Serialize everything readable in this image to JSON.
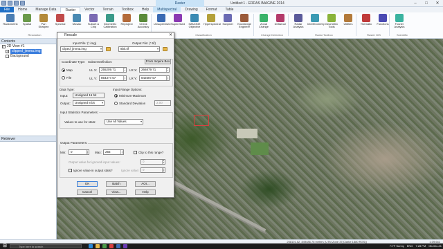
{
  "window": {
    "title": "Untitled:1 - ERDAS IMAGINE 2014",
    "context_group": "Raster",
    "controls": [
      "–",
      "□",
      "✕"
    ]
  },
  "tabs": [
    "File",
    "Home",
    "Manage Data",
    "Raster",
    "Vector",
    "Terrain",
    "Toolbox",
    "Help",
    "Multispectral",
    "Drawing",
    "Format",
    "Table"
  ],
  "ribbon": {
    "buttons": [
      {
        "label": "Radiometric",
        "color": "#4a7db3"
      },
      {
        "label": "Spatial",
        "color": "#6a9a4a"
      },
      {
        "label": "Pan Sharpen",
        "color": "#b38a3a"
      },
      {
        "label": "Spectral",
        "color": "#c04a4a"
      },
      {
        "label": "Mosaic",
        "color": "#4a8ab3"
      },
      {
        "label": "Subset & Chip",
        "color": "#7a6ab3"
      },
      {
        "label": "Geometric Calibration",
        "color": "#3a9a8a"
      },
      {
        "label": "Reproject",
        "color": "#b36a3a"
      },
      {
        "label": "Check Accuracy",
        "color": "#5a8a3a"
      },
      {
        "label": "Unsupervised",
        "color": "#3a6ab3"
      },
      {
        "label": "Supervised",
        "color": "#8a3ab3"
      },
      {
        "label": "IMAGINE Objective",
        "color": "#3a8ab3"
      },
      {
        "label": "Hyperspectral",
        "color": "#b3a03a"
      },
      {
        "label": "Subpixel",
        "color": "#6a6ab3"
      },
      {
        "label": "Knowledge Engineer",
        "color": "#9a5a3a"
      },
      {
        "label": "Zonal Change",
        "color": "#3ab36a"
      },
      {
        "label": "DeltaCue",
        "color": "#b33a6a"
      },
      {
        "label": "Radar Analysis",
        "color": "#5a5a9a"
      },
      {
        "label": "Interferometry",
        "color": "#3a9ab3"
      },
      {
        "label": "Geometric Tools",
        "color": "#8ab33a"
      },
      {
        "label": "Utilities",
        "color": "#b37a3a"
      },
      {
        "label": "Thematic",
        "color": "#c03a3a"
      },
      {
        "label": "Functions",
        "color": "#4a4ab3"
      },
      {
        "label": "Fourier Analysis",
        "color": "#3ab3a0"
      }
    ],
    "groups": [
      "Resolution",
      "Classification",
      "Change Detection",
      "Radar Toolbox",
      "Raster GIS",
      "Scientific"
    ]
  },
  "contents": {
    "title": "Contents",
    "view": "2D View #1",
    "layer": "clipped_jimma.img",
    "background": "Background"
  },
  "retriever": {
    "title": "Retriever"
  },
  "dialog": {
    "title": "Rescale",
    "input_file_label": "Input File: (*.img)",
    "input_file_value": "cliped_jimma.img",
    "output_file_label": "Output File: (*.tif)",
    "output_file_value": "8bit.tif",
    "coord_type_label": "Coordinate Type:",
    "coord_map": "Map",
    "coord_file": "File",
    "subset_label": "Subset Definition:",
    "from_inquire": "From Inquire Box",
    "ulx_label": "UL X:",
    "ulx_value": "255209.71",
    "lrx_label": "LR X:",
    "lrx_value": "266879.71",
    "uly_label": "UL Y:",
    "uly_value": "854377.57",
    "lry_label": "LR Y:",
    "lry_value": "842587.57",
    "data_type_label": "Data Type:",
    "input_label": "Input:",
    "input_type": "Unsigned 16 bit",
    "output_label": "Output:",
    "output_type": "Unsigned 8 bit",
    "input_range_label": "Input Range Options:",
    "min_max": "Minimum-Maximum",
    "std_dev": "Standard Deviation",
    "std_dev_value": "2.00",
    "input_stats_label": "Input Statistics Parameters:",
    "values_for_stats_label": "Values to use for stats:",
    "values_for_stats_value": "Use All Values",
    "output_params_label": "Output Parameters:",
    "min_label": "Min:",
    "min_value": "0",
    "max_label": "Max:",
    "max_value": "255",
    "clip_to_range": "Clip to this range?",
    "output_ignore_label": "Output value for ignored input values:",
    "output_ignore_value": "0",
    "ignore_in_stats": "Ignore value in output stats?",
    "ignore_value_label": "Ignore value:",
    "ignore_value": "0",
    "ok": "OK",
    "batch": "Batch",
    "aoi": "AOI...",
    "cancel": "Cancel",
    "view": "View...",
    "help": "Help"
  },
  "status": {
    "coords": "258101.52, 849486.76 meters (UTM Zone 37(Clarke 1880 RGS))",
    "zoom": "1:39,641"
  },
  "taskbar": {
    "search_placeholder": "Type here to search",
    "weather": "71°F  Sunny",
    "lang": "ENG",
    "time": "7:28 PM",
    "date": "06-Dec-21"
  }
}
